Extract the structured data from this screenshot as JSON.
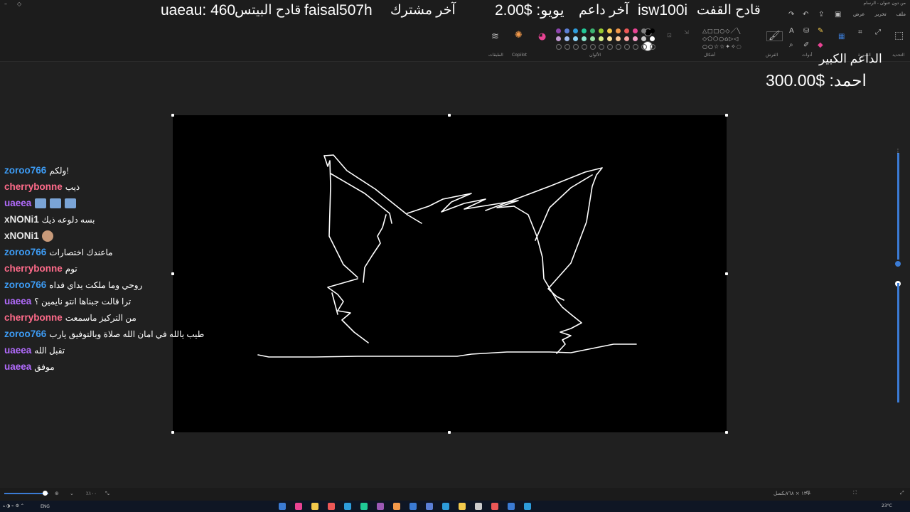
{
  "window": {
    "title": "من دون عنوان - الرسام"
  },
  "menu": [
    "ملف",
    "تحرير",
    "عرض"
  ],
  "ribbon_groups": {
    "selection": "التحديد",
    "image": "الصورة",
    "tools": "أدوات",
    "brushes": "الفرش",
    "shapes": "أشكال",
    "colors": "الألوان",
    "copilot": "Copilot",
    "layers": "الطبقات"
  },
  "stream_overlay": {
    "bits_leader_label": "قادح البيتس",
    "bits_leader_value": "uaeau: 460",
    "last_subscriber_label": "آخر مشترك",
    "last_subscriber_value": "faisal507h",
    "last_donor_label": "آخر داعم",
    "last_donor_value": "يويو: $2.00",
    "gift_leader_label": "قادح القفت",
    "gift_leader_value": "isw100i",
    "top_supporter_label": "الداعم الكبير",
    "top_supporter_value": "احمد: $300.00"
  },
  "palette": {
    "row1": [
      "#8e44ad",
      "#5b7fd6",
      "#2d9cdb",
      "#20c997",
      "#3cb371",
      "#9acd32",
      "#f2c94c",
      "#f2994a",
      "#eb5757",
      "#e84393",
      "#7f7f7f",
      "#000000"
    ],
    "row2": [
      "#c39bd3",
      "#a3bff0",
      "#8fd3f4",
      "#8ee6cf",
      "#9be3a8",
      "#d8ef8a",
      "#fbe49a",
      "#f8c99b",
      "#f6a6a6",
      "#f3a1c8",
      "#c8c8c8",
      "#ffffff"
    ],
    "primary": "#000000",
    "secondary": "#ffffff"
  },
  "chat": [
    {
      "user": "zoroo766",
      "color": "#3d9cf5",
      "message": "ولكم!"
    },
    {
      "user": "cherrybonne",
      "color": "#ff6b8a",
      "message": "ذيب"
    },
    {
      "user": "uaeea",
      "color": "#b36cff",
      "message": "",
      "emotes": 3
    },
    {
      "user": "xNONi1",
      "color": "#e8e8e8",
      "message": "بسه دلوعه ذيك"
    },
    {
      "user": "xNONi1",
      "color": "#e8e8e8",
      "message": "",
      "avatar": true
    },
    {
      "user": "zoroo766",
      "color": "#3d9cf5",
      "message": "ماعندك اختصارات"
    },
    {
      "user": "cherrybonne",
      "color": "#ff6b8a",
      "message": "توم"
    },
    {
      "user": "zoroo766",
      "color": "#3d9cf5",
      "message": "روحي وما ملكت يداي فداه"
    },
    {
      "user": "uaeea",
      "color": "#b36cff",
      "message": "ترا قالت جبناها انتو نايمين ؟"
    },
    {
      "user": "cherrybonne",
      "color": "#ff6b8a",
      "message": "من التركيز ماسمعت"
    },
    {
      "user": "zoroo766",
      "color": "#3d9cf5",
      "message": "طيب يالله في امان الله صلاة وبالتوفيق يارب"
    },
    {
      "user": "uaeea",
      "color": "#b36cff",
      "message": "تقبل الله"
    },
    {
      "user": "uaeea",
      "color": "#b36cff",
      "message": "موفق"
    }
  ],
  "status": {
    "canvas_size": "١٣٦٠ × ٧٦٨بكسل",
    "zoom": "٪١٠٠"
  },
  "taskbar": {
    "language": "ENG",
    "temperature": "23°C"
  }
}
